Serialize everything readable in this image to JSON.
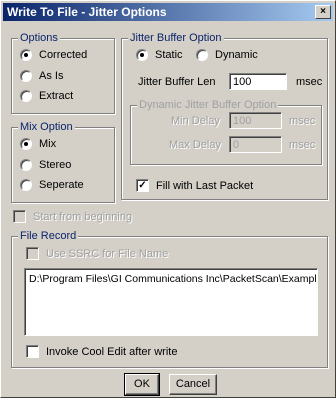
{
  "window": {
    "title": "Write To File - Jitter Options",
    "close_glyph": "×"
  },
  "options": {
    "legend": "Options",
    "items": [
      {
        "label": "Corrected",
        "selected": true
      },
      {
        "label": "As Is",
        "selected": false
      },
      {
        "label": "Extract",
        "selected": false
      }
    ]
  },
  "mix": {
    "legend": "Mix Option",
    "items": [
      {
        "label": "Mix",
        "selected": true
      },
      {
        "label": "Stereo",
        "selected": false
      },
      {
        "label": "Seperate",
        "selected": false
      }
    ]
  },
  "jitter": {
    "legend": "Jitter Buffer Option",
    "static_label": "Static",
    "dynamic_label": "Dynamic",
    "len_label": "Jitter Buffer Len",
    "len_value": "100",
    "len_unit": "msec",
    "dynamic_group": {
      "legend": "Dynamic Jitter Buffer Option",
      "min_label": "Min Delay",
      "min_value": "100",
      "min_unit": "msec",
      "max_label": "Max Delay",
      "max_value": "0",
      "max_unit": "msec"
    },
    "fill_label": "Fill with Last Packet",
    "fill_checked": true
  },
  "start_from_beginning": {
    "label": "Start from beginning",
    "checked": false
  },
  "file_record": {
    "legend": "File Record",
    "use_ssrc_label": "Use SSRC for File Name",
    "path": "D:\\Program Files\\GI Communications Inc\\PacketScan\\Example...",
    "invoke_label": "Invoke Cool Edit after write"
  },
  "buttons": {
    "ok": "OK",
    "cancel": "Cancel"
  }
}
